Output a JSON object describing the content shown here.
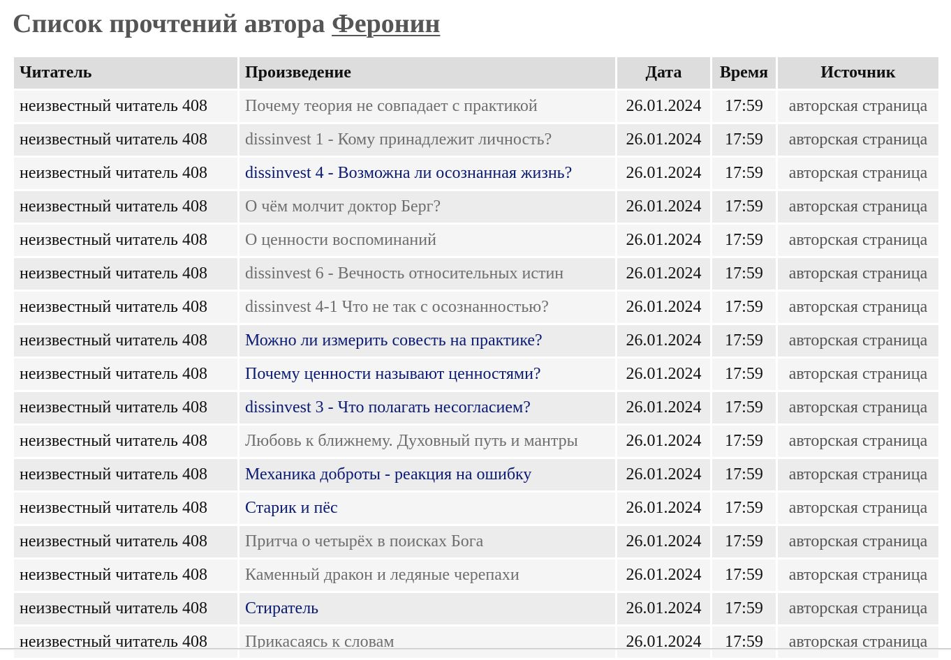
{
  "header": {
    "title_prefix": "Список прочтений автора ",
    "author_name": "Феронин"
  },
  "table": {
    "columns": {
      "reader": "Читатель",
      "work": "Произведение",
      "date": "Дата",
      "time": "Время",
      "source": "Источник"
    },
    "rows": [
      {
        "reader": "неизвестный читатель 408",
        "work": "Почему теория не совпадает с практикой",
        "visited": true,
        "date": "26.01.2024",
        "time": "17:59",
        "source": "авторская страница"
      },
      {
        "reader": "неизвестный читатель 408",
        "work": "dissinvest 1 - Кому принадлежит личность?",
        "visited": true,
        "date": "26.01.2024",
        "time": "17:59",
        "source": "авторская страница"
      },
      {
        "reader": "неизвестный читатель 408",
        "work": "dissinvest 4 - Возможна ли осознанная жизнь?",
        "visited": false,
        "date": "26.01.2024",
        "time": "17:59",
        "source": "авторская страница"
      },
      {
        "reader": "неизвестный читатель 408",
        "work": "О чём молчит доктор Берг?",
        "visited": true,
        "date": "26.01.2024",
        "time": "17:59",
        "source": "авторская страница"
      },
      {
        "reader": "неизвестный читатель 408",
        "work": "О ценности воспоминаний",
        "visited": true,
        "date": "26.01.2024",
        "time": "17:59",
        "source": "авторская страница"
      },
      {
        "reader": "неизвестный читатель 408",
        "work": "dissinvest 6 - Вечность относительных истин",
        "visited": true,
        "date": "26.01.2024",
        "time": "17:59",
        "source": "авторская страница"
      },
      {
        "reader": "неизвестный читатель 408",
        "work": "dissinvest 4-1 Что не так с осознанностью?",
        "visited": true,
        "date": "26.01.2024",
        "time": "17:59",
        "source": "авторская страница"
      },
      {
        "reader": "неизвестный читатель 408",
        "work": "Можно ли измерить совесть на практике?",
        "visited": false,
        "date": "26.01.2024",
        "time": "17:59",
        "source": "авторская страница"
      },
      {
        "reader": "неизвестный читатель 408",
        "work": "Почему ценности называют ценностями?",
        "visited": false,
        "date": "26.01.2024",
        "time": "17:59",
        "source": "авторская страница"
      },
      {
        "reader": "неизвестный читатель 408",
        "work": "dissinvest 3 - Что полагать несогласием?",
        "visited": false,
        "date": "26.01.2024",
        "time": "17:59",
        "source": "авторская страница"
      },
      {
        "reader": "неизвестный читатель 408",
        "work": "Любовь к ближнему. Духовный путь и мантры",
        "visited": true,
        "date": "26.01.2024",
        "time": "17:59",
        "source": "авторская страница"
      },
      {
        "reader": "неизвестный читатель 408",
        "work": "Механика доброты - реакция на ошибку",
        "visited": false,
        "date": "26.01.2024",
        "time": "17:59",
        "source": "авторская страница"
      },
      {
        "reader": "неизвестный читатель 408",
        "work": "Старик и пёс",
        "visited": false,
        "date": "26.01.2024",
        "time": "17:59",
        "source": "авторская страница"
      },
      {
        "reader": "неизвестный читатель 408",
        "work": "Притча о четырёх в поисках Бога",
        "visited": true,
        "date": "26.01.2024",
        "time": "17:59",
        "source": "авторская страница"
      },
      {
        "reader": "неизвестный читатель 408",
        "work": "Каменный дракон и ледяные черепахи",
        "visited": true,
        "date": "26.01.2024",
        "time": "17:59",
        "source": "авторская страница"
      },
      {
        "reader": "неизвестный читатель 408",
        "work": "Стиратель",
        "visited": false,
        "date": "26.01.2024",
        "time": "17:59",
        "source": "авторская страница"
      },
      {
        "reader": "неизвестный читатель 408",
        "work": "Прикасаясь к словам",
        "visited": true,
        "date": "26.01.2024",
        "time": "17:59",
        "source": "авторская страница"
      }
    ]
  },
  "colors": {
    "title": "#555555",
    "header_bg": "#dddddd",
    "row_odd_bg": "#f5f5f5",
    "row_even_bg": "#ececec",
    "link_visited": "#6e6e6e",
    "link_unvisited": "#0b1a73"
  }
}
